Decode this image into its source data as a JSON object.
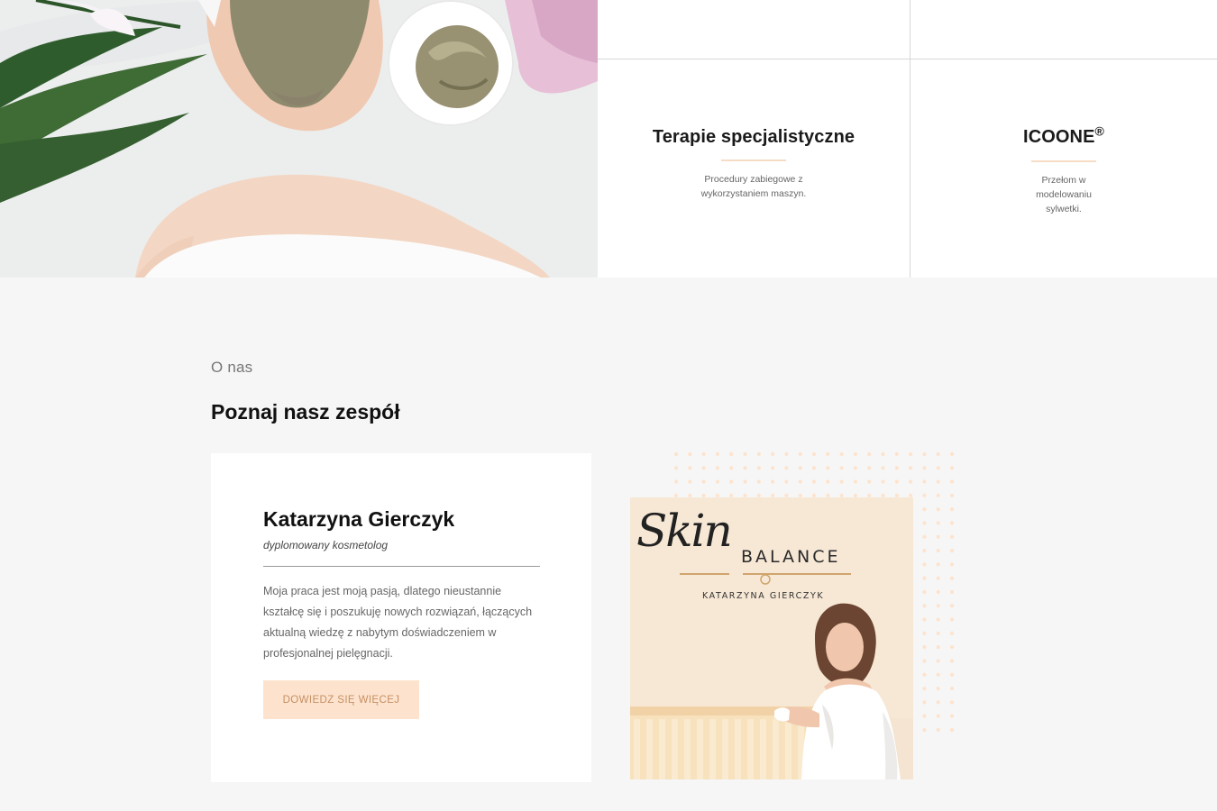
{
  "services": [
    {
      "title": "Terapie specjalistyczne",
      "title_sup": "",
      "description": "Procedury zabiegowe z wykorzystaniem maszyn."
    },
    {
      "title": "ICOONE",
      "title_sup": "®",
      "description": "Przełom w modelowaniu sylwetki."
    }
  ],
  "about": {
    "eyebrow": "O nas",
    "heading": "Poznaj nasz zespół",
    "member": {
      "name": "Katarzyna Gierczyk",
      "role": "dyplomowany kosmetolog",
      "bio": "Moja praca jest moją pasją, dlatego nieustannie kształcę się i poszukuję nowych rozwiązań, łączących aktualną wiedzę z nabytym doświadczeniem w profesjonalnej pielęgnacji.",
      "button_label": "DOWIEDZ SIĘ WIĘCEJ"
    },
    "photo_sign": {
      "script": "Skin",
      "brand": "BALANCE",
      "owner": "KATARZYNA GIERCZYK"
    }
  },
  "colors": {
    "accent": "#fde3cd",
    "accent_text": "#c58f64",
    "section_background": "#f6f6f6"
  }
}
